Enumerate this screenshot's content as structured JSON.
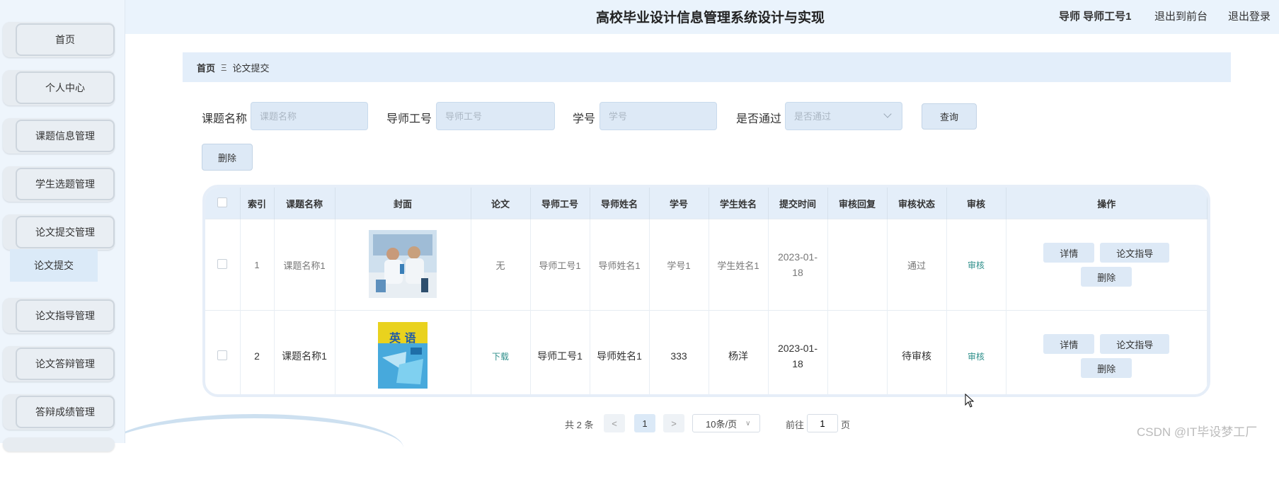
{
  "header": {
    "title": "高校毕业设计信息管理系统设计与实现",
    "user": "导师 导师工号1",
    "front": "退出到前台",
    "logout": "退出登录"
  },
  "sidebar": {
    "items": [
      "首页",
      "个人中心",
      "课题信息管理",
      "学生选题管理",
      "论文提交管理",
      "论文指导管理",
      "论文答辩管理",
      "答辩成绩管理"
    ],
    "submenu": "论文提交"
  },
  "breadcrumb": {
    "home": "首页",
    "sep": "Ξ",
    "current": "论文提交"
  },
  "search": {
    "topic_label": "课题名称",
    "topic_placeholder": "课题名称",
    "tutor_label": "导师工号",
    "tutor_placeholder": "导师工号",
    "sno_label": "学号",
    "sno_placeholder": "学号",
    "pass_label": "是否通过",
    "pass_placeholder": "是否通过",
    "query": "查询",
    "delete": "删除"
  },
  "table": {
    "headers": [
      "索引",
      "课题名称",
      "封面",
      "论文",
      "导师工号",
      "导师姓名",
      "学号",
      "学生姓名",
      "提交时间",
      "审核回复",
      "审核状态",
      "审核",
      "操作"
    ],
    "rows": [
      {
        "index": "1",
        "topic": "课题名称1",
        "paper": "无",
        "tutor_no": "导师工号1",
        "tutor_name": "导师姓名1",
        "sno": "学号1",
        "sname": "学生姓名1",
        "time": "2023-01-18",
        "reply": "",
        "status": "通过",
        "audit": "审核"
      },
      {
        "index": "2",
        "topic": "课题名称1",
        "paper": "下载",
        "tutor_no": "导师工号1",
        "tutor_name": "导师姓名1",
        "sno": "333",
        "sname": "杨洋",
        "time": "2023-01-18",
        "reply": "",
        "status": "待审核",
        "audit": "审核"
      }
    ],
    "ops": {
      "detail": "详情",
      "guide": "论文指导",
      "delete": "删除"
    },
    "cover2_text": "英 语"
  },
  "pagination": {
    "total": "共 2 条",
    "prev": "<",
    "page": "1",
    "next": ">",
    "size": "10条/页",
    "goto": "前往",
    "goto_value": "1",
    "unit": "页"
  },
  "watermark": "CSDN @IT毕设梦工厂"
}
